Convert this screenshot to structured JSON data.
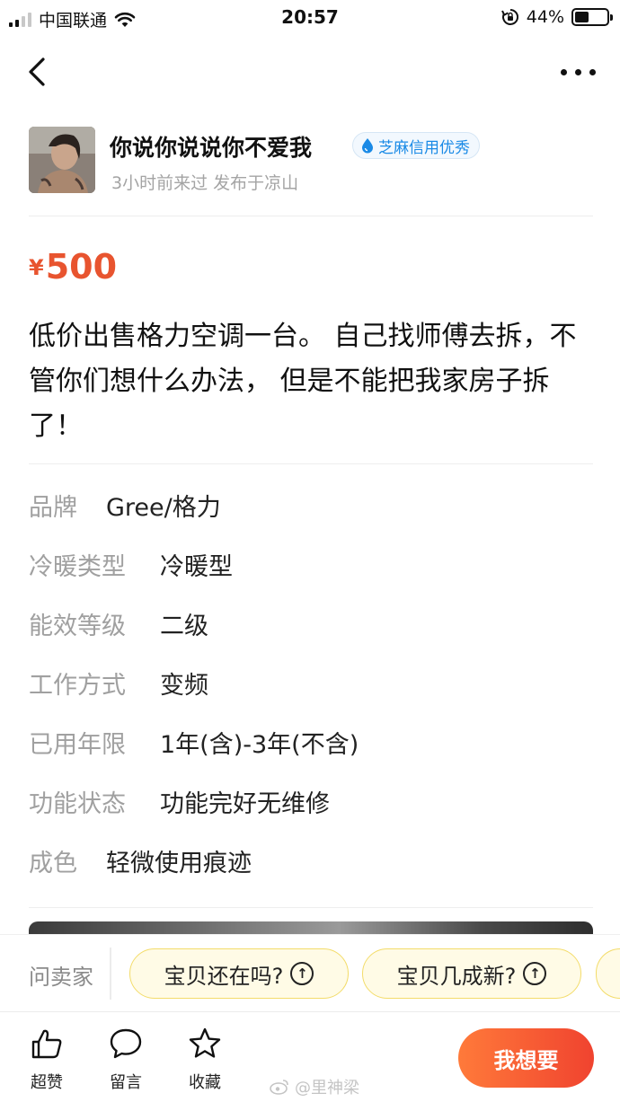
{
  "status_bar": {
    "carrier": "中国联通",
    "time": "20:57",
    "battery_percent": "44%",
    "battery_level": 0.44,
    "icons": [
      "signal-icon",
      "wifi-icon",
      "rotation-lock-icon",
      "battery-icon"
    ]
  },
  "nav": {
    "back_icon": "chevron-left-icon",
    "more_icon": "more-dots-icon"
  },
  "seller": {
    "name": "你说你说说你不爱我",
    "badge": "芝麻信用优秀",
    "badge_icon": "sesame-drop-icon",
    "meta": "3小时前来过 发布于凉山",
    "badge_color": "#1a8ae6"
  },
  "listing": {
    "currency": "¥",
    "price": "500",
    "price_color": "#e8542f",
    "description": "低价出售格力空调一台。 自己找师傅去拆，不管你们想什么办法， 但是不能把我家房子拆了！"
  },
  "specs": [
    {
      "key": "品牌",
      "value": "Gree/格力"
    },
    {
      "key": "冷暖类型",
      "value": "冷暖型"
    },
    {
      "key": "能效等级",
      "value": "二级"
    },
    {
      "key": "工作方式",
      "value": "变频"
    },
    {
      "key": "已用年限",
      "value": "1年(含)-3年(不含)"
    },
    {
      "key": "功能状态",
      "value": "功能完好无维修"
    },
    {
      "key": "成色",
      "value": "轻微使用痕迹"
    }
  ],
  "ask_bar": {
    "label": "问卖家",
    "chips": [
      {
        "label": "宝贝还在吗?",
        "icon": "arrow-up-circle-icon"
      },
      {
        "label": "宝贝几成新?",
        "icon": "arrow-up-circle-icon"
      }
    ],
    "chip_color": "#fffbe6"
  },
  "bottom_bar": {
    "actions": [
      {
        "label": "超赞",
        "icon": "thumbs-up-icon"
      },
      {
        "label": "留言",
        "icon": "comment-icon"
      },
      {
        "label": "收藏",
        "icon": "star-icon"
      }
    ],
    "primary_button": "我想要",
    "primary_color": "#f0432f",
    "watermark": "@里神梁"
  }
}
